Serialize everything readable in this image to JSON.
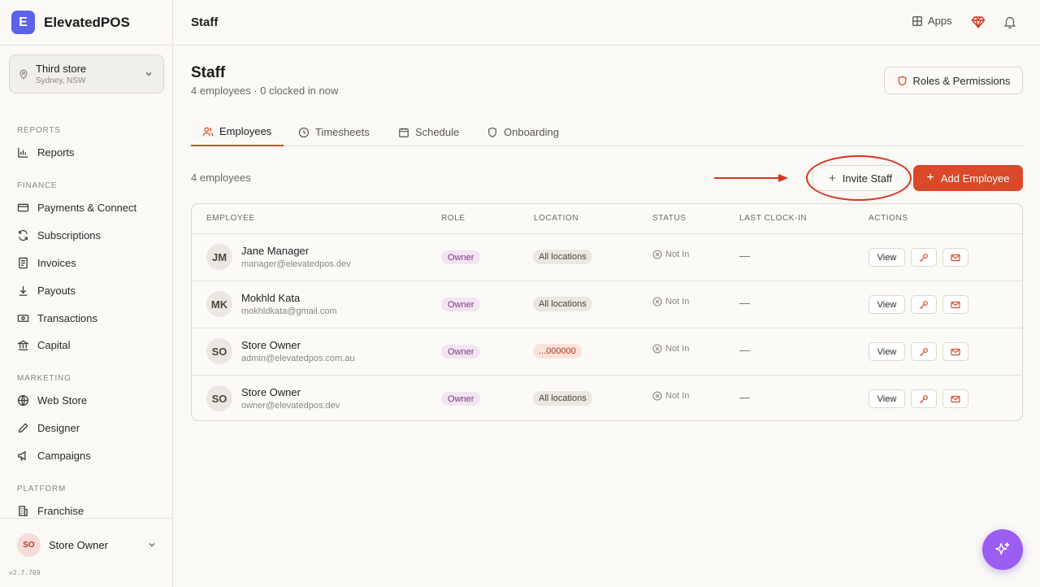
{
  "brand": {
    "logo_letter": "E",
    "name": "ElevatedPOS",
    "logo_color": "#5b63e8"
  },
  "store": {
    "name": "Third store",
    "location": "Sydney, NSW"
  },
  "nav": {
    "reports_section": "REPORTS",
    "reports": "Reports",
    "finance_section": "FINANCE",
    "payments": "Payments & Connect",
    "subscriptions": "Subscriptions",
    "invoices": "Invoices",
    "payouts": "Payouts",
    "transactions": "Transactions",
    "capital": "Capital",
    "marketing_section": "MARKETING",
    "webstore": "Web Store",
    "designer": "Designer",
    "campaigns": "Campaigns",
    "platform_section": "PLATFORM",
    "franchise": "Franchise"
  },
  "user": {
    "initials": "SO",
    "name": "Store Owner"
  },
  "version": "v2.7.709",
  "topbar": {
    "title": "Staff",
    "apps_label": "Apps"
  },
  "page": {
    "title": "Staff",
    "subtitle": "4 employees · 0 clocked in now",
    "roles_button": "Roles & Permissions"
  },
  "tabs": {
    "employees": "Employees",
    "timesheets": "Timesheets",
    "schedule": "Schedule",
    "onboarding": "Onboarding"
  },
  "toolbar": {
    "count": "4 employees",
    "invite_label": "Invite Staff",
    "add_label": "Add Employee",
    "plus": "+"
  },
  "table": {
    "headers": {
      "employee": "EMPLOYEE",
      "role": "ROLE",
      "location": "LOCATION",
      "status": "STATUS",
      "last_clock_in": "LAST CLOCK-IN",
      "actions": "ACTIONS"
    },
    "rows": [
      {
        "initials": "JM",
        "name": "Jane Manager",
        "email": "manager@elevatedpos.dev",
        "role": "Owner",
        "location": "All locations",
        "status": "Not In",
        "last_clock_in": "—",
        "view": "View"
      },
      {
        "initials": "MK",
        "name": "Mokhld Kata",
        "email": "mokhldkata@gmail.com",
        "role": "Owner",
        "location": "All locations",
        "status": "Not In",
        "last_clock_in": "—",
        "view": "View"
      },
      {
        "initials": "SO",
        "name": "Store Owner",
        "email": "admin@elevatedpos.com.au",
        "role": "Owner",
        "location": "...000000",
        "status": "Not In",
        "last_clock_in": "—",
        "view": "View"
      },
      {
        "initials": "SO",
        "name": "Store Owner",
        "email": "owner@elevatedpos.dev",
        "role": "Owner",
        "location": "All locations",
        "status": "Not In",
        "last_clock_in": "—",
        "view": "View"
      }
    ]
  },
  "colors": {
    "accent": "#d9492a",
    "fab": "#9a5ef2",
    "annotation": "#d63520"
  }
}
